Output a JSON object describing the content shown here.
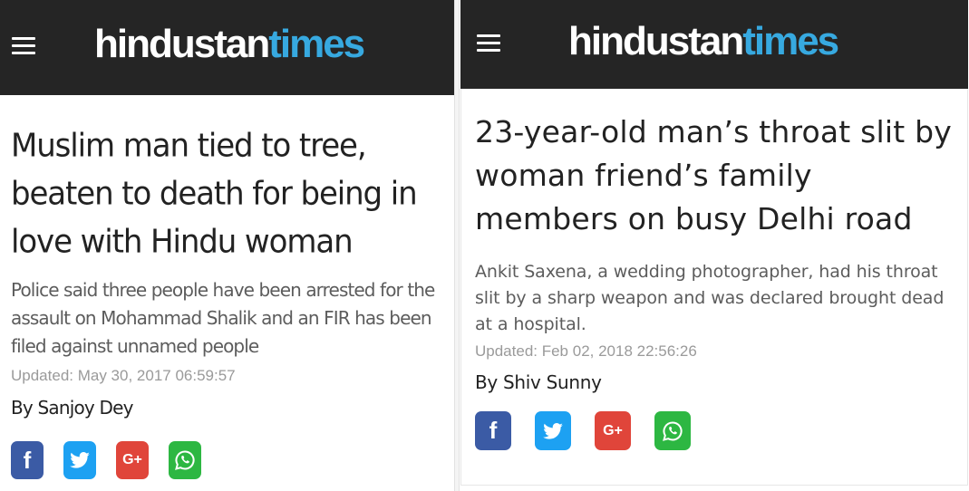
{
  "brand": {
    "part1": "hindustan",
    "part2": "times",
    "color_header": "#252525",
    "color_accent": "#37a9e0"
  },
  "left_article": {
    "headline": "Muslim man tied to tree, beaten to death for being in love with Hindu woman",
    "summary": "Police said three people have been arrested for the assault on Mohammad Shalik and an FIR has been filed against unnamed people",
    "updated": "Updated: May 30, 2017 06:59:57",
    "byline": "By Sanjoy Dey"
  },
  "right_article": {
    "headline": "23-year-old man’s throat slit by woman friend’s family members on busy Delhi road",
    "summary": "Ankit Saxena, a wedding photographer, had his throat slit by a sharp weapon and was declared brought dead at a hospital.",
    "updated": "Updated: Feb 02, 2018 22:56:26",
    "byline": "By Shiv Sunny"
  },
  "share": {
    "facebook_icon": "facebook-icon",
    "facebook_glyph": "f",
    "twitter_icon": "twitter-icon",
    "googleplus_icon": "google-plus-icon",
    "googleplus_glyph": "G+",
    "whatsapp_icon": "whatsapp-icon",
    "colors": {
      "facebook": "#3b5ba5",
      "twitter": "#1da1f2",
      "googleplus": "#e0453a",
      "whatsapp": "#2db742"
    }
  }
}
